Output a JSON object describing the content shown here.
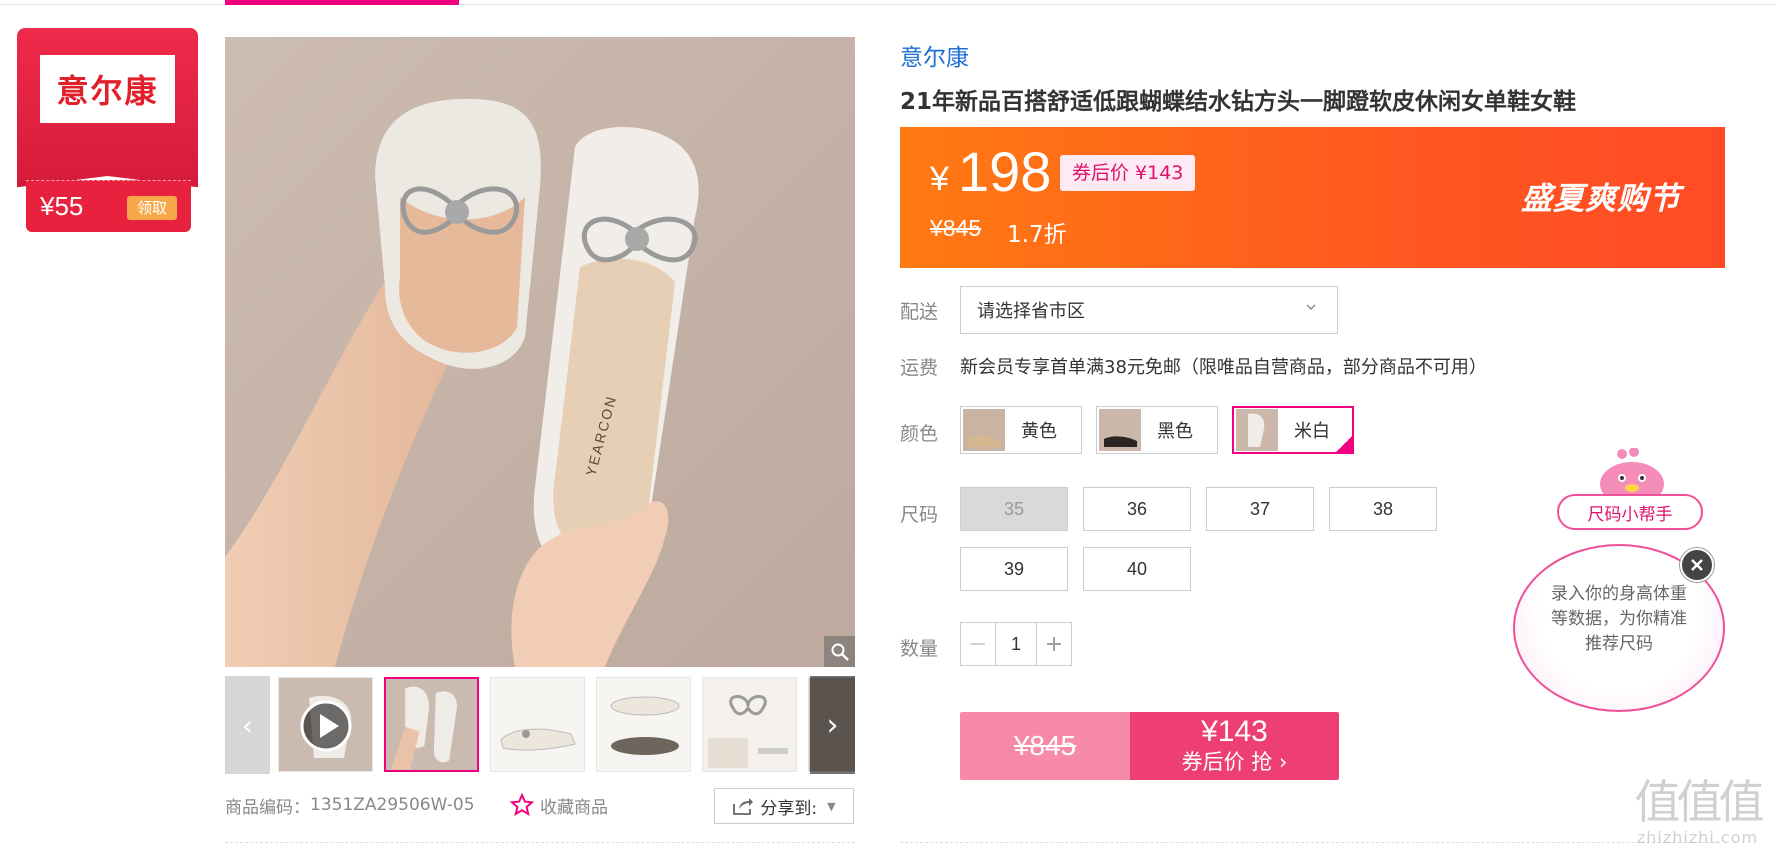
{
  "brand_badge": {
    "logo_text": "意尔康",
    "coupon_value": "¥55",
    "coupon_button": "领取"
  },
  "gallery": {
    "main_image_alt": "",
    "thumbnails": [
      "video",
      "bow-shoes-hand",
      "single-shoe-side",
      "shoes-top-bottom",
      "bow-detail"
    ],
    "active_thumbnail_index": 1
  },
  "product": {
    "brand": "意尔康",
    "title": "21年新品百搭舒适低跟蝴蝶结水钻方头一脚蹬软皮休闲女单鞋女鞋",
    "code_label": "商品编码：",
    "code_value": "1351ZA29506W-05",
    "favorite_label": "收藏商品",
    "share_label": "分享到:"
  },
  "price": {
    "currency": "¥",
    "current": "198",
    "after_coupon_tag": "券后价 ¥143",
    "original": "¥845",
    "discount": "1.7折",
    "promo_name": "盛夏爽购节"
  },
  "delivery": {
    "label": "配送",
    "select_value": "请选择省市区"
  },
  "shipping": {
    "label": "运费",
    "text": "新会员专享首单满38元免邮（限唯品自营商品，部分商品不可用）"
  },
  "colors": {
    "label": "颜色",
    "options": [
      {
        "name": "黄色",
        "selected": false
      },
      {
        "name": "黑色",
        "selected": false
      },
      {
        "name": "米白",
        "selected": true
      }
    ]
  },
  "sizes": {
    "label": "尺码",
    "options": [
      {
        "value": "35",
        "disabled": true
      },
      {
        "value": "36",
        "disabled": false
      },
      {
        "value": "37",
        "disabled": false
      },
      {
        "value": "38",
        "disabled": false
      },
      {
        "value": "39",
        "disabled": false
      },
      {
        "value": "40",
        "disabled": false
      }
    ]
  },
  "quantity": {
    "label": "数量",
    "value": "1",
    "minus": "−",
    "plus": "+"
  },
  "buy_button": {
    "original": "¥845",
    "price": "¥143",
    "label": "券后价 抢 ›"
  },
  "size_helper": {
    "title": "尺码小帮手",
    "text": "录入你的身高体重等数据，为你精准推荐尺码"
  },
  "watermark": {
    "big": "值值值",
    "small": "zhizhizhi.com"
  },
  "colors_theme": {
    "accent": "#f10180",
    "price_banner": "#ff6a14",
    "brand_link": "#1e6fd8",
    "buy": "#ed3f73"
  }
}
